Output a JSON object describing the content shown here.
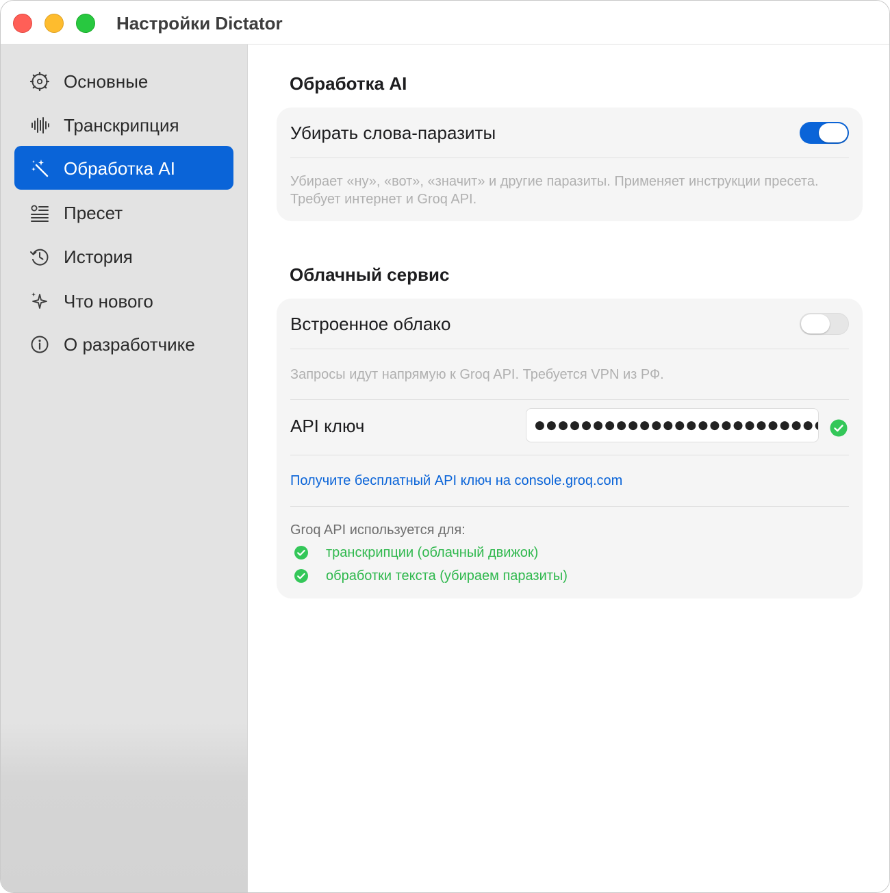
{
  "window": {
    "title": "Настройки Dictator",
    "traffic_lights": {
      "close": "#ff5f57",
      "minimize": "#febc2e",
      "maximize": "#28c840"
    }
  },
  "sidebar": {
    "items": [
      {
        "label": "Основные",
        "icon": "gear-icon",
        "active": false
      },
      {
        "label": "Транскрипция",
        "icon": "waveform-icon",
        "active": false
      },
      {
        "label": "Обработка AI",
        "icon": "magic-wand-icon",
        "active": true
      },
      {
        "label": "Пресет",
        "icon": "list-icon",
        "active": false
      },
      {
        "label": "История",
        "icon": "history-icon",
        "active": false
      },
      {
        "label": "Что нового",
        "icon": "sparkles-icon",
        "active": false
      },
      {
        "label": "О разработчике",
        "icon": "info-icon",
        "active": false
      }
    ]
  },
  "ai_section": {
    "title": "Обработка AI",
    "filler_toggle_label": "Убирать слова-паразиты",
    "filler_toggle_on": true,
    "description": "Убирает «ну», «вот», «значит» и другие паразиты. Применяет инструкции пресета. Требует интернет и Groq API."
  },
  "cloud_section": {
    "title": "Облачный сервис",
    "builtin_toggle_label": "Встроенное облако",
    "builtin_toggle_on": false,
    "description": "Запросы идут напрямую к Groq API. Требуется VPN из РФ.",
    "api_key_label": "API ключ",
    "api_key_value": "●●●●●●●●●●●●●●●●●●●●●●●●●●",
    "api_key_valid_icon": "checkmark-circle-icon",
    "link_text": "Получите бесплатный API ключ на console.groq.com",
    "groq_used_for_label": "Groq API используется для:",
    "uses": [
      "транскрипции (облачный движок)",
      "обработки текста (убираем паразиты)"
    ]
  },
  "colors": {
    "accent": "#0a64d8",
    "success": "#34c759",
    "success_text": "#2fb84d"
  }
}
